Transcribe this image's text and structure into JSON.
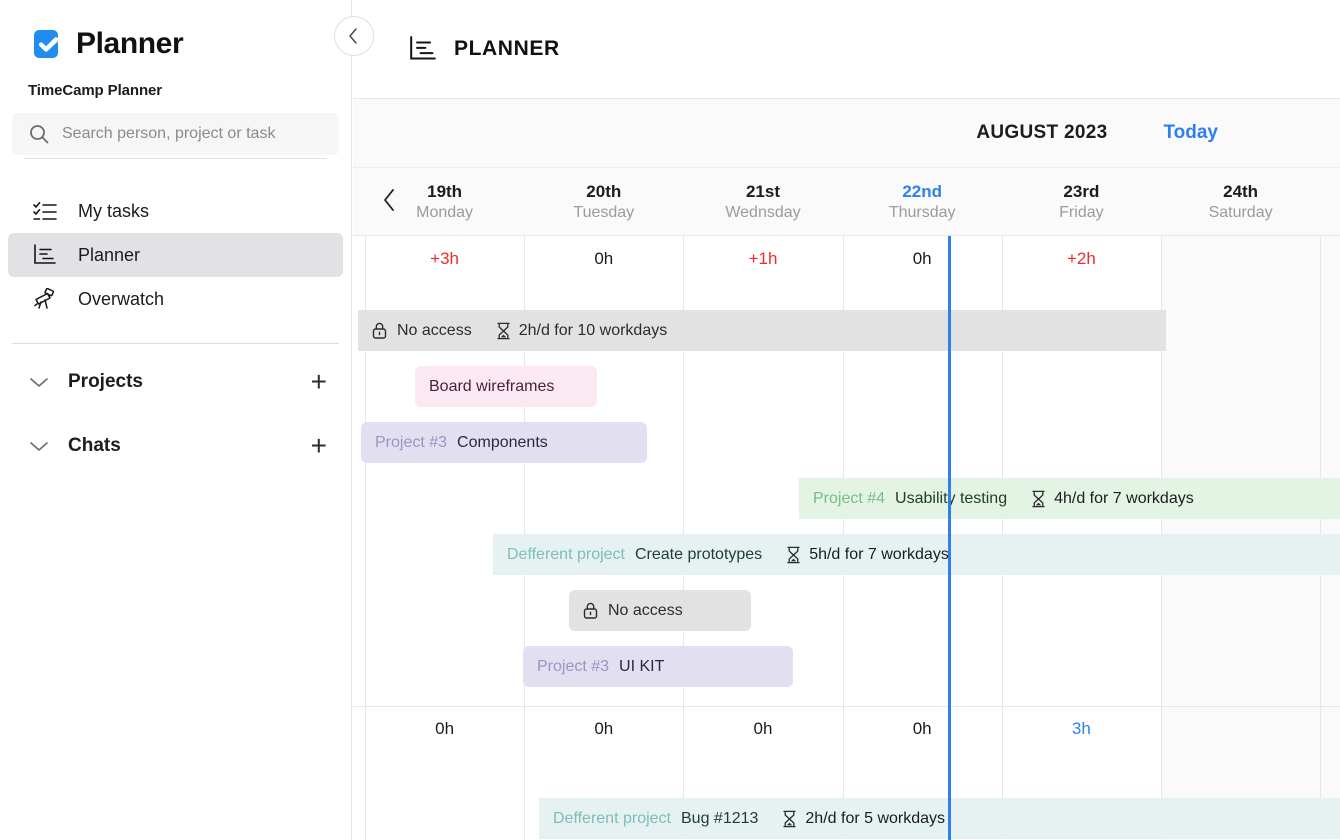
{
  "sidebar": {
    "brand": "Planner",
    "brand_logo_color": "#1f8cf0",
    "workspace": "TimeCamp Planner",
    "search": {
      "placeholder": "Search person, project or task",
      "value": ""
    },
    "nav": [
      {
        "label": "My tasks",
        "icon": "checklist-icon",
        "active": false
      },
      {
        "label": "Planner",
        "icon": "planner-icon",
        "active": true
      },
      {
        "label": "Overwatch",
        "icon": "telescope-icon",
        "active": false
      }
    ],
    "sections": [
      {
        "label": "Projects",
        "chevron": "chevron-down-icon",
        "add": "+"
      },
      {
        "label": "Chats",
        "chevron": "chevron-down-icon",
        "add": "+"
      }
    ]
  },
  "header": {
    "title": "PLANNER",
    "icon": "planner-icon",
    "collapse_icon": "chevron-left-icon"
  },
  "toolbar": {
    "month": "AUGUST 2023",
    "today_label": "Today",
    "today_color": "#2f80ed",
    "prev_icon": "chevron-left-icon"
  },
  "calendar": {
    "days": [
      {
        "num": "19th",
        "name": "Monday",
        "today": false,
        "weekend": false
      },
      {
        "num": "20th",
        "name": "Tuesday",
        "today": false,
        "weekend": false
      },
      {
        "num": "21st",
        "name": "Wednsday",
        "today": false,
        "weekend": false
      },
      {
        "num": "22nd",
        "name": "Thursday",
        "today": true,
        "weekend": false
      },
      {
        "num": "23rd",
        "name": "Friday",
        "today": false,
        "weekend": false
      },
      {
        "num": "24th",
        "name": "Saturday",
        "today": false,
        "weekend": true
      }
    ],
    "rows": [
      {
        "hours": [
          {
            "text": "+3h",
            "tone": "red"
          },
          {
            "text": "0h",
            "tone": "dark"
          },
          {
            "text": "+1h",
            "tone": "red"
          },
          {
            "text": "0h",
            "tone": "dark"
          },
          {
            "text": "+2h",
            "tone": "red"
          },
          {
            "text": "",
            "tone": "dark"
          }
        ],
        "bars": [
          {
            "style": "grey",
            "locked": true,
            "proj": "",
            "task": "No access",
            "meta": "2h/d for 10 workdays",
            "meta_icon": "hourglass-icon"
          },
          {
            "style": "pink",
            "locked": false,
            "proj": "",
            "task": "Board wireframes",
            "meta": ""
          },
          {
            "style": "purple",
            "locked": false,
            "proj": "Project #3",
            "task": "Components",
            "meta": ""
          },
          {
            "style": "green",
            "locked": false,
            "proj": "Project #4",
            "task": "Usability testing",
            "meta": "4h/d for 7 workdays",
            "meta_icon": "hourglass-icon"
          },
          {
            "style": "teal",
            "locked": false,
            "proj": "Defferent project",
            "task": "Create prototypes",
            "meta": "5h/d for 7 workdays",
            "meta_icon": "hourglass-icon"
          },
          {
            "style": "grey",
            "locked": true,
            "proj": "",
            "task": "No access",
            "meta": ""
          },
          {
            "style": "purple",
            "locked": false,
            "proj": "Project #3",
            "task": "UI KIT",
            "meta": ""
          }
        ]
      },
      {
        "hours": [
          {
            "text": "0h",
            "tone": "dark"
          },
          {
            "text": "0h",
            "tone": "dark"
          },
          {
            "text": "0h",
            "tone": "dark"
          },
          {
            "text": "0h",
            "tone": "dark"
          },
          {
            "text": "3h",
            "tone": "blue"
          },
          {
            "text": "",
            "tone": "dark"
          }
        ],
        "bars": [
          {
            "style": "teal",
            "locked": false,
            "proj": "Defferent project",
            "task": "Bug  #1213",
            "meta": "2h/d for 5 workdays",
            "meta_icon": "hourglass-icon"
          }
        ]
      }
    ]
  }
}
